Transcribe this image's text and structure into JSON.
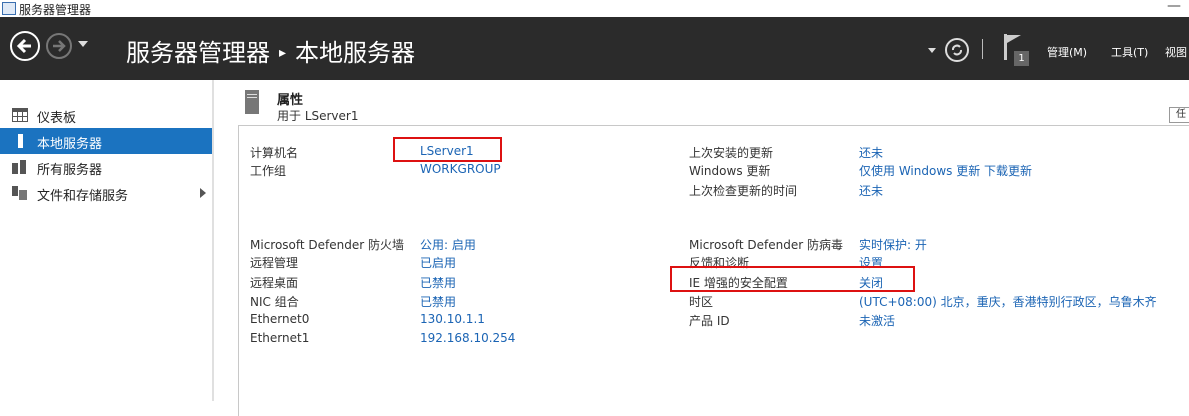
{
  "window": {
    "title": "服务器管理器",
    "minimize_glyph": "—"
  },
  "header": {
    "breadcrumb_root": "服务器管理器",
    "breadcrumb_sep": "▸",
    "breadcrumb_current": "本地服务器",
    "flag_badge": "1",
    "menus": [
      "管理(M)",
      "工具(T)",
      "视图"
    ]
  },
  "sidebar": {
    "items": [
      {
        "label": "仪表板",
        "icon": "dashboard-icon"
      },
      {
        "label": "本地服务器",
        "icon": "server-icon"
      },
      {
        "label": "所有服务器",
        "icon": "servers-icon"
      },
      {
        "label": "文件和存储服务",
        "icon": "storage-icon"
      }
    ]
  },
  "properties": {
    "title": "属性",
    "subtitle": "用于 LServer1",
    "task_label": "任",
    "left_group1": [
      {
        "key": "计算机名",
        "value": "LServer1"
      },
      {
        "key": "工作组",
        "value": "WORKGROUP"
      }
    ],
    "left_group2": [
      {
        "key": "Microsoft Defender 防火墙",
        "value": "公用: 启用"
      },
      {
        "key": "远程管理",
        "value": "已启用"
      },
      {
        "key": "远程桌面",
        "value": "已禁用"
      },
      {
        "key": "NIC 组合",
        "value": "已禁用"
      },
      {
        "key": "Ethernet0",
        "value": "130.10.1.1"
      },
      {
        "key": "Ethernet1",
        "value": "192.168.10.254"
      }
    ],
    "right_group1": [
      {
        "key": "上次安装的更新",
        "value": "还未"
      },
      {
        "key": "Windows 更新",
        "value": "仅使用 Windows 更新 下载更新"
      },
      {
        "key": "上次检查更新的时间",
        "value": "还未"
      }
    ],
    "right_group2": [
      {
        "key": "Microsoft Defender 防病毒",
        "value": "实时保护: 开"
      },
      {
        "key": "反馈和诊断",
        "value": "设置"
      },
      {
        "key": "IE 增强的安全配置",
        "value": "关闭"
      },
      {
        "key": "时区",
        "value": "(UTC+08:00) 北京，重庆，香港特别行政区，乌鲁木齐"
      },
      {
        "key": "产品 ID",
        "value": "未激活"
      }
    ]
  },
  "colors": {
    "header_bg": "#2b2b2b",
    "accent": "#1b73c0",
    "link": "#1b64b4",
    "highlight": "#dd1111"
  }
}
